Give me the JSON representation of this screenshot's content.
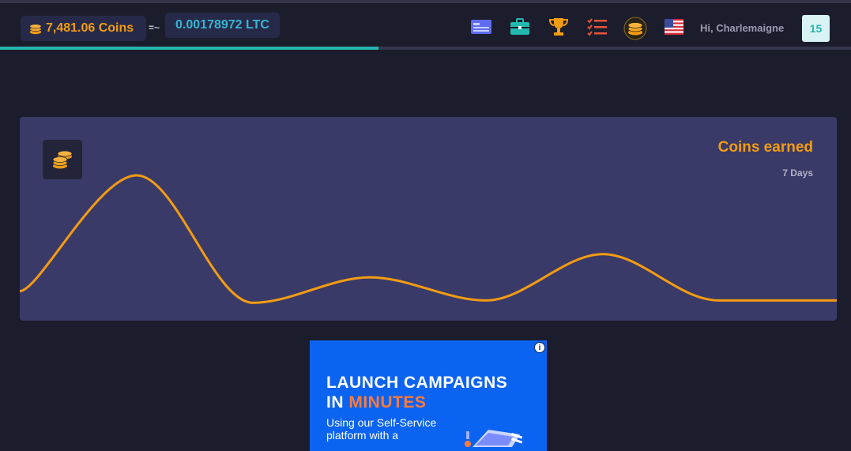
{
  "header": {
    "coins_balance": "7,481.06 Coins",
    "approx_sign": "=~",
    "ltc_value": "0.00178972 LTC",
    "greeting": "Hi, Charlemaigne",
    "level": "15",
    "progress_fraction": 0.445,
    "icons": [
      "id-card-icon",
      "briefcase-icon",
      "trophy-icon",
      "tasks-icon",
      "coin-stack-icon",
      "us-flag-icon"
    ]
  },
  "earnings_card": {
    "title": "Coins earned",
    "subtitle": "7 Days",
    "icon": "coins-icon"
  },
  "chart_data": {
    "type": "line",
    "title": "Coins earned",
    "subtitle": "7 Days",
    "x": [
      1,
      2,
      3,
      4,
      5,
      6,
      7
    ],
    "values": [
      10,
      110,
      0,
      22,
      2,
      42,
      2
    ],
    "ylim": [
      -10,
      155
    ],
    "grid": false,
    "legend": "none",
    "color": "#f39c12",
    "smooth": true,
    "axes_visible": false
  },
  "ad": {
    "headline_line1": "LAUNCH CAMPAIGNS",
    "headline_line2_prefix": "IN",
    "headline_line2_highlight": "MINUTES",
    "body": "Using our Self-Service platform with a",
    "info_icon": "i"
  },
  "colors": {
    "background": "#1c1d2c",
    "accent_orange": "#f39c12",
    "accent_teal": "#27b5b0",
    "card": "#3a3a68",
    "ad_blue": "#0b63f1"
  }
}
